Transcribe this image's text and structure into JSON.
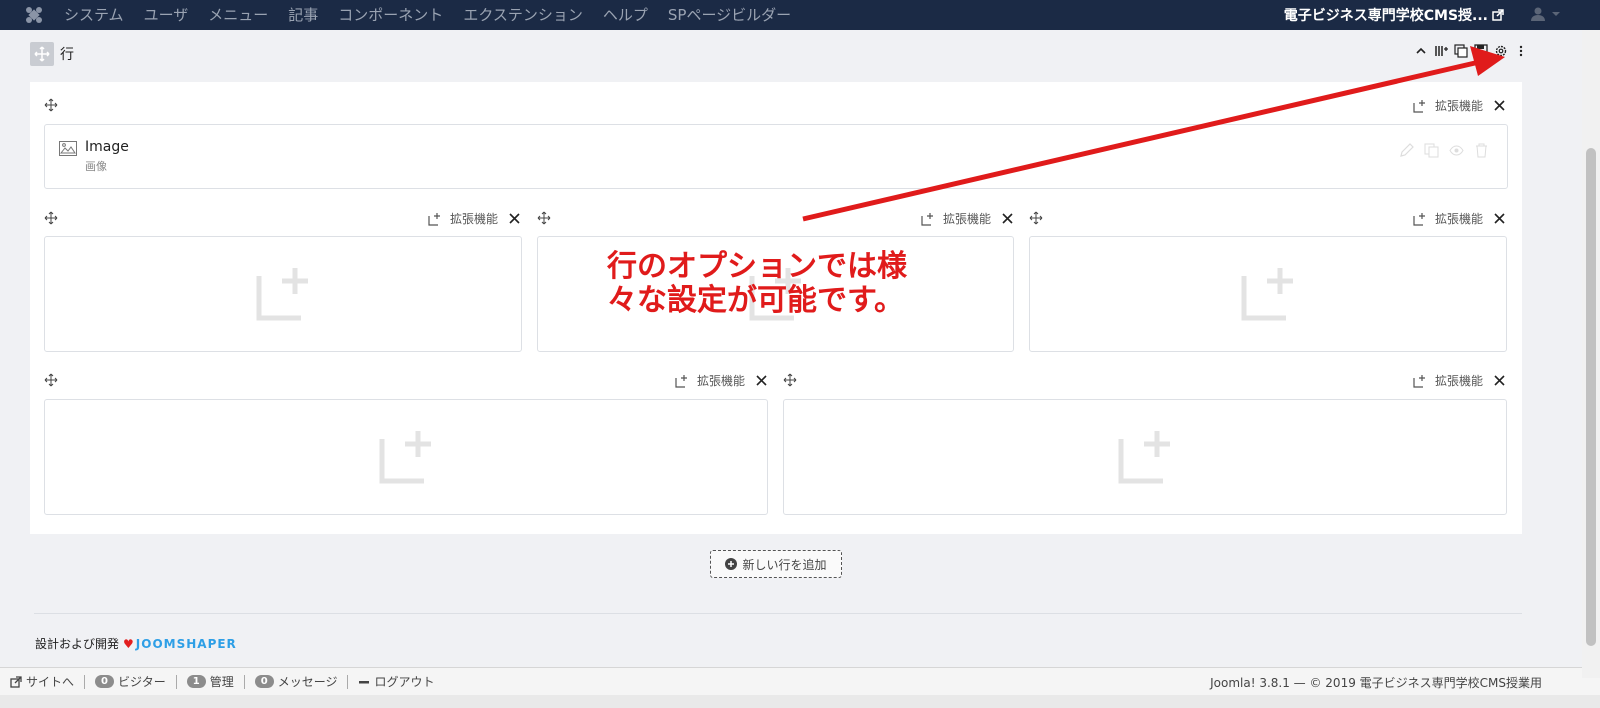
{
  "topbar": {
    "menu": [
      "システム",
      "ユーザ",
      "メニュー",
      "記事",
      "コンポーネント",
      "エクステンション",
      "ヘルプ",
      "SPページビルダー"
    ],
    "site_title": "電子ビジネス専門学校CMS授..."
  },
  "row": {
    "title": "行",
    "columns_label": "拡張機能",
    "addon": {
      "name": "Image",
      "sub": "画像"
    }
  },
  "add_row_label": "新しい行を追加",
  "footer": {
    "credit_prefix": "設計および開発",
    "brand": "JOOMSHAPER"
  },
  "statusbar": {
    "site_link": "サイトへ",
    "visitors": {
      "count": "0",
      "label": "ビジター"
    },
    "admins": {
      "count": "1",
      "label": "管理"
    },
    "messages": {
      "count": "0",
      "label": "メッセージ"
    },
    "logout": "ログアウト",
    "version": "Joomla! 3.8.1 — © 2019 電子ビジネス専門学校CMS授業用"
  },
  "annotation": {
    "text": "行のオプションでは様\n々な設定が可能です。",
    "color": "#e01b1b"
  },
  "colors": {
    "navbar": "#1b2a45",
    "accent_red": "#e01b1b",
    "brand_blue": "#2e9fe6"
  }
}
